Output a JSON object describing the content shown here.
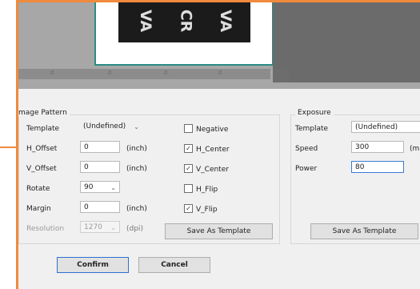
{
  "preview": {
    "art_text": [
      "VA",
      "CR",
      "VA"
    ],
    "ruler_ticks": [
      "0",
      "0",
      "0",
      "0"
    ]
  },
  "image_pattern": {
    "title": "mage Pattern",
    "template_label": "Template",
    "template_value": "(Undefined)",
    "h_offset_label": "H_Offset",
    "h_offset_value": "0",
    "h_offset_unit": "(inch)",
    "v_offset_label": "V_Offset",
    "v_offset_value": "0",
    "v_offset_unit": "(inch)",
    "rotate_label": "Rotate",
    "rotate_value": "90",
    "margin_label": "Margin",
    "margin_value": "0",
    "margin_unit": "(inch)",
    "resolution_label": "Resolution",
    "resolution_value": "1270",
    "resolution_unit": "(dpi)",
    "checkboxes": [
      {
        "label": "Negative",
        "checked": false
      },
      {
        "label": "H_Center",
        "checked": true
      },
      {
        "label": "V_Center",
        "checked": true
      },
      {
        "label": "H_Flip",
        "checked": false
      },
      {
        "label": "V_Flip",
        "checked": true
      }
    ],
    "save_template_label": "Save As Template"
  },
  "exposure": {
    "title": "Exposure",
    "template_label": "Template",
    "template_value": "(Undefined)",
    "speed_label": "Speed",
    "speed_value": "300",
    "speed_unit": "(m",
    "power_label": "Power",
    "power_value": "80",
    "save_template_label": "Save As Template"
  },
  "footer": {
    "confirm_label": "Confirm",
    "cancel_label": "Cancel"
  },
  "colors": {
    "highlight_border": "#f08a3c",
    "canvas_border": "#2a8c85",
    "focus_border": "#3a7bd5"
  }
}
